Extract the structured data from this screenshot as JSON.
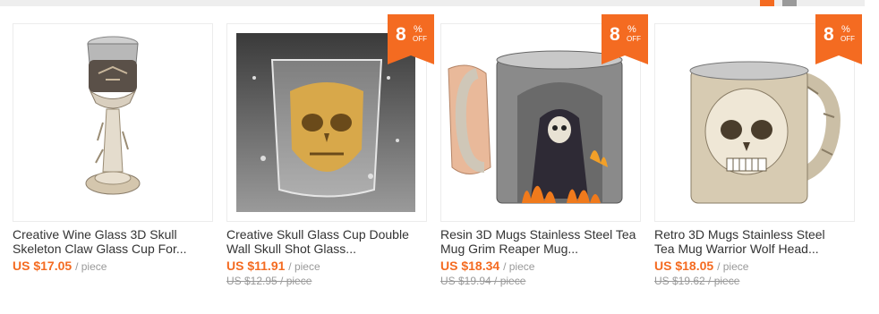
{
  "products": [
    {
      "title_line1": "Creative Wine Glass 3D Skull",
      "title_line2": "Skeleton Claw Glass Cup For...",
      "price": "US $17.05",
      "unit": "/ piece",
      "old_price": "",
      "discount": ""
    },
    {
      "title_line1": "Creative Skull Glass Cup Double",
      "title_line2": "Wall Skull Shot Glass...",
      "price": "US $11.91",
      "unit": "/ piece",
      "old_price": "US $12.95 / piece",
      "discount": "8"
    },
    {
      "title_line1": "Resin 3D Mugs Stainless Steel Tea",
      "title_line2": "Mug Grim Reaper Mug...",
      "price": "US $18.34",
      "unit": "/ piece",
      "old_price": "US $19.94 / piece",
      "discount": "8"
    },
    {
      "title_line1": "Retro 3D Mugs Stainless Steel",
      "title_line2": "Tea Mug Warrior Wolf Head...",
      "price": "US $18.05",
      "unit": "/ piece",
      "old_price": "US $19.62 / piece",
      "discount": "8"
    }
  ],
  "badge": {
    "percent": "%",
    "off": "OFF",
    "color": "#f46b21"
  },
  "colors": {
    "price": "#f46b21",
    "pager_active": "#f46b21",
    "pager_inactive": "#9a9a9a"
  }
}
